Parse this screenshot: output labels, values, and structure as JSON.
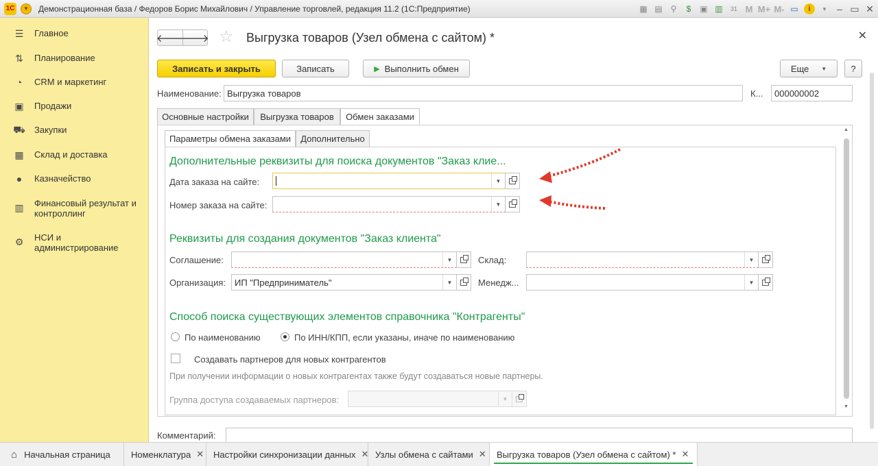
{
  "window": {
    "title": "Демонстрационная база / Федоров Борис Михайлович / Управление торговлей, редакция 11.2  (1С:Предприятие)"
  },
  "titlebar_icons": [
    "save-icon",
    "print-icon",
    "search-icon",
    "money-icon",
    "documents-icon",
    "calculator-icon",
    "calendar-icon",
    "M",
    "M+",
    "M-",
    "panel-icon",
    "info-icon",
    "minimize-icon",
    "maximize-icon",
    "close-icon"
  ],
  "sidebar": {
    "items": [
      {
        "label": "Главное",
        "icon": "menu-icon"
      },
      {
        "label": "Планирование",
        "icon": "planning-icon"
      },
      {
        "label": "CRM и маркетинг",
        "icon": "crm-icon"
      },
      {
        "label": "Продажи",
        "icon": "bag-icon"
      },
      {
        "label": "Закупки",
        "icon": "cart-icon"
      },
      {
        "label": "Склад и доставка",
        "icon": "warehouse-icon"
      },
      {
        "label": "Казначейство",
        "icon": "coin-icon"
      },
      {
        "label": "Финансовый результат и",
        "label2": "контроллинг",
        "icon": "bar-chart-icon"
      },
      {
        "label": "НСИ и",
        "label2": "администрирование",
        "icon": "gear-icon"
      }
    ]
  },
  "form": {
    "title": "Выгрузка товаров (Узел обмена с сайтом) *",
    "buttons": {
      "save_close": "Записать и закрыть",
      "save": "Записать",
      "run_exchange": "Выполнить обмен",
      "more": "Еще",
      "help": "?"
    },
    "name_label": "Наименование:",
    "name_value": "Выгрузка товаров",
    "code_label": "К...",
    "code_value": "000000002",
    "tabs": [
      "Основные настройки",
      "Выгрузка товаров",
      "Обмен заказами"
    ],
    "subtabs": [
      "Параметры обмена заказами",
      "Дополнительно"
    ],
    "section1": {
      "title": "Дополнительные реквизиты для поиска документов \"Заказ клие...",
      "order_date_label": "Дата заказа на сайте:",
      "order_date_value": "",
      "order_number_label": "Номер заказа на сайте:",
      "order_number_value": ""
    },
    "section2": {
      "title": "Реквизиты для создания документов \"Заказ клиента\"",
      "agreement_label": "Соглашение:",
      "agreement_value": "",
      "warehouse_label": "Склад:",
      "warehouse_value": "",
      "organization_label": "Организация:",
      "organization_value": "ИП \"Предприниматель\"",
      "manager_label": "Менедж...",
      "manager_value": ""
    },
    "section3": {
      "title": "Способ поиска существующих элементов справочника \"Контрагенты\"",
      "radio_by_name": "По наименованию",
      "radio_by_inn": "По ИНН/КПП, если указаны, иначе по наименованию",
      "selected": "by_inn",
      "create_partners_label": "Создавать партнеров для новых контрагентов",
      "create_partners_checked": false,
      "hint": "При получении информации о новых контрагентах также будут создаваться новые партнеры.",
      "access_group_label": "Группа доступа создаваемых партнеров:",
      "access_group_value": ""
    },
    "comment_label": "Комментарий:"
  },
  "bottom_tabs": [
    {
      "label": "Начальная страница",
      "closable": false
    },
    {
      "label": "Номенклатура",
      "closable": true
    },
    {
      "label": "Настройки синхронизации данных",
      "closable": true
    },
    {
      "label": "Узлы обмена с сайтами",
      "closable": true
    },
    {
      "label": "Выгрузка товаров (Узел обмена с сайтом) *",
      "closable": true,
      "active": true
    }
  ],
  "colors": {
    "sidebar_bg": "#fbed9e",
    "primary_button": "#f5d000",
    "section_title": "#1f9a4a",
    "annotation_arrow": "#e0392b"
  }
}
